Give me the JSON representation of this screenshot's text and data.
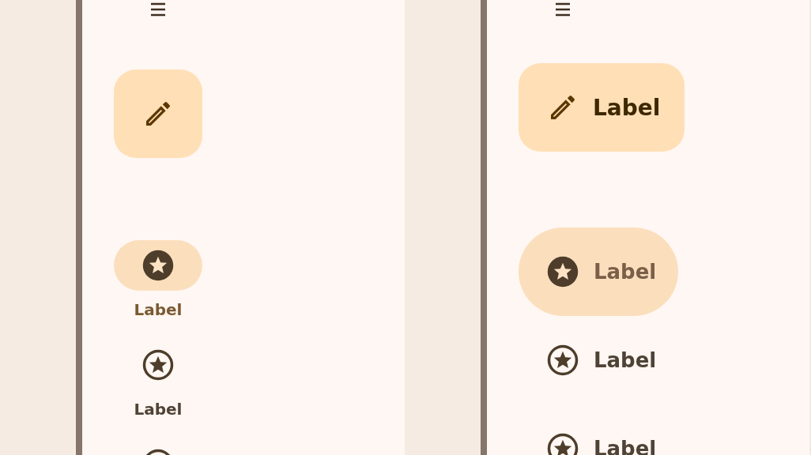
{
  "rail": {
    "fab": {
      "kind": "compact"
    },
    "items": [
      {
        "label": "Label",
        "selected": true
      },
      {
        "label": "Label",
        "selected": false
      },
      {
        "selected": false
      }
    ]
  },
  "drawer": {
    "fab": {
      "kind": "extended",
      "label": "Label"
    },
    "items": [
      {
        "label": "Label",
        "selected": true
      },
      {
        "label": "Label",
        "selected": false
      },
      {
        "label": "Label",
        "selected": false
      }
    ]
  }
}
